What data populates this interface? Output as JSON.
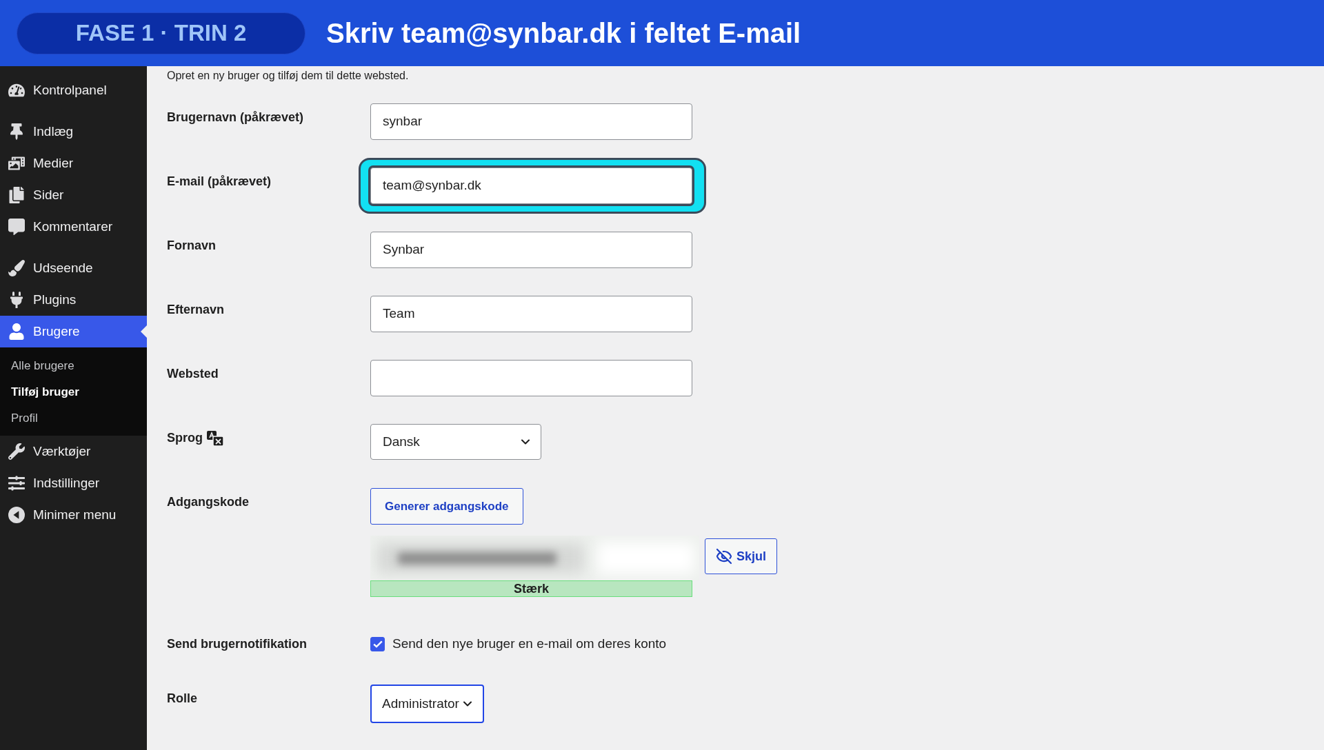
{
  "banner": {
    "step": "FASE 1 · TRIN 2",
    "instruction": "Skriv team@synbar.dk i feltet E-mail"
  },
  "sidebar": {
    "groups": [
      {
        "items": [
          {
            "label": "Kontrolpanel",
            "selected": false
          }
        ]
      },
      {
        "items": [
          {
            "label": "Indlæg",
            "selected": false
          },
          {
            "label": "Medier",
            "selected": false
          },
          {
            "label": "Sider",
            "selected": false
          },
          {
            "label": "Kommentarer",
            "selected": false
          }
        ]
      },
      {
        "items": [
          {
            "label": "Udseende",
            "selected": false
          },
          {
            "label": "Plugins",
            "selected": false
          },
          {
            "label": "Brugere",
            "selected": true,
            "children": [
              {
                "label": "Alle brugere",
                "selected": false
              },
              {
                "label": "Tilføj bruger",
                "selected": true
              },
              {
                "label": "Profil",
                "selected": false
              }
            ]
          },
          {
            "label": "Værktøjer",
            "selected": false
          },
          {
            "label": "Indstillinger",
            "selected": false
          },
          {
            "label": "Minimer menu",
            "selected": false
          }
        ]
      }
    ]
  },
  "form": {
    "intro": "Opret en ny bruger og tilføj dem til dette websted.",
    "rows": [
      {
        "kind": "text",
        "label": "Brugernavn (påkrævet)",
        "value": "synbar",
        "highlighted": false
      },
      {
        "kind": "text",
        "label": "E-mail (påkrævet)",
        "value": "team@synbar.dk",
        "highlighted": true
      },
      {
        "kind": "text",
        "label": "Fornavn",
        "value": "Synbar",
        "highlighted": false
      },
      {
        "kind": "text",
        "label": "Efternavn",
        "value": "Team",
        "highlighted": false
      },
      {
        "kind": "text",
        "label": "Websted",
        "highlighted": false
      },
      {
        "kind": "language",
        "label": "Sprog",
        "value": "Dansk",
        "focused": false
      },
      {
        "kind": "password",
        "label": "Adgangskode",
        "button": "Generer adgangskode",
        "toggle": "Skjul",
        "strength": "Stærk"
      },
      {
        "kind": "checkbox",
        "label": "Send brugernotifikation",
        "checked": true,
        "text": "Send den nye bruger en e-mail om deres konto"
      },
      {
        "kind": "select",
        "label": "Rolle",
        "value": "Administrator",
        "focused": true
      }
    ]
  }
}
